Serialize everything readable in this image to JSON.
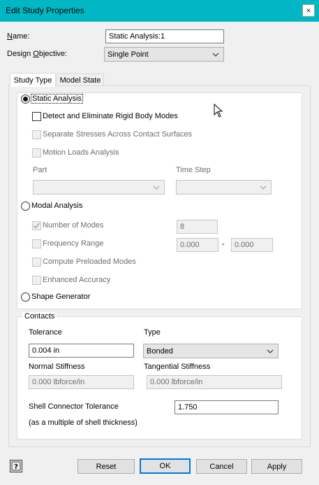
{
  "window": {
    "title": "Edit Study Properties",
    "close_glyph": "×"
  },
  "form": {
    "name_label_underlined": "N",
    "name_label_rest": "ame:",
    "name_value": "Static Analysis:1",
    "design_label_pre": "Design ",
    "design_label_underlined": "O",
    "design_label_post": "bjective:",
    "design_value": "Single Point"
  },
  "tabs": [
    {
      "label": "Study Type"
    },
    {
      "label": "Model State"
    }
  ],
  "study": {
    "static_label": "Static Analysis",
    "detect_label": "Detect and Eliminate Rigid Body Modes",
    "separate_label": "Separate Stresses Across Contact Surfaces",
    "motion_label": "Motion Loads Analysis",
    "part_label": "Part",
    "timestep_label": "Time Step",
    "modal_label": "Modal Analysis",
    "num_modes_label": "Number of Modes",
    "num_modes_value": "8",
    "freq_range_label": "Frequency Range",
    "freq_from": "0.000",
    "freq_dash": "-",
    "freq_to": "0.000",
    "preloaded_label": "Compute Preloaded Modes",
    "enhanced_label": "Enhanced Accuracy",
    "shape_label": "Shape Generator"
  },
  "contacts": {
    "group_label": "Contacts",
    "tolerance_label": "Tolerance",
    "tolerance_value": "0.004 in",
    "type_label": "Type",
    "type_value": "Bonded",
    "normal_label": "Normal Stiffness",
    "normal_value": "0.000 lbforce/in",
    "tangential_label": "Tangential Stiffness",
    "tangential_value": "0.000 lbforce/in",
    "shell_label": "Shell Connector Tolerance",
    "shell_sub": "(as a multiple of shell thickness)",
    "shell_value": "1.750"
  },
  "buttons": {
    "reset": "Reset",
    "ok": "OK",
    "cancel": "Cancel",
    "apply": "Apply"
  },
  "icons": {
    "close": "close-icon",
    "chevron": "chevron-down-icon",
    "check": "checkmark-icon",
    "help": "help-icon",
    "cursor": "mouse-pointer-icon",
    "help_glyph": "?"
  },
  "colors": {
    "titlebar": "#00b7c3",
    "default_button_border": "#0078d7"
  }
}
